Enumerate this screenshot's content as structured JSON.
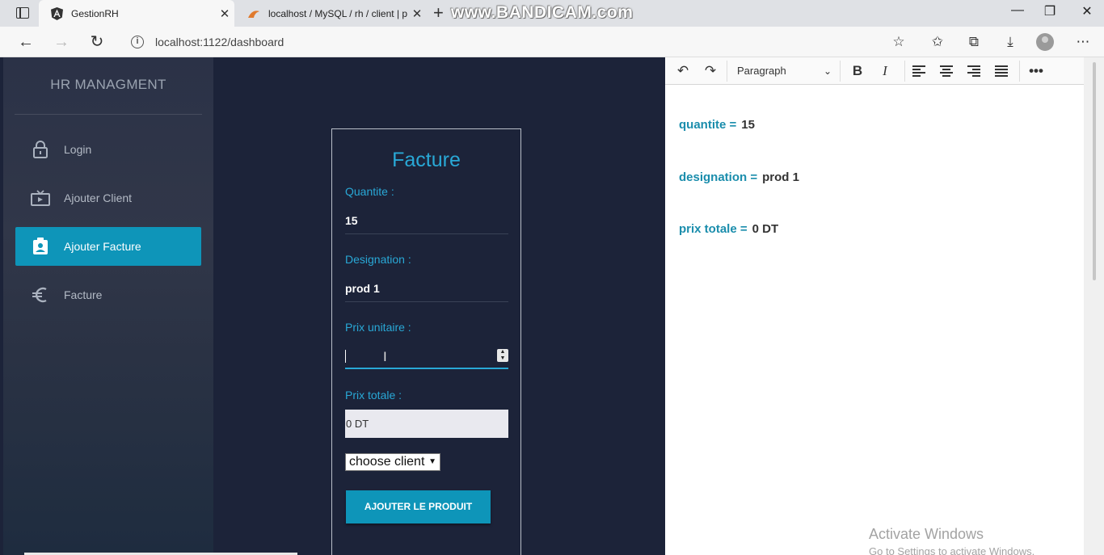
{
  "browser": {
    "tabs": [
      {
        "title": "GestionRH",
        "active": true
      },
      {
        "title": "localhost / MySQL / rh / client | p",
        "active": false
      }
    ],
    "recording_watermark": "www.BANDICAM.com",
    "url": "localhost:1122/dashboard"
  },
  "sidebar": {
    "brand": "HR MANAGMENT",
    "items": [
      {
        "label": "Login",
        "icon": "lock-icon",
        "active": false
      },
      {
        "label": "Ajouter Client",
        "icon": "tv-icon",
        "active": false
      },
      {
        "label": "Ajouter Facture",
        "icon": "clipboard-user-icon",
        "active": true
      },
      {
        "label": "Facture",
        "icon": "euro-icon",
        "active": false
      }
    ]
  },
  "form": {
    "title": "Facture",
    "quantite": {
      "label": "Quantite :",
      "value": "15"
    },
    "designation": {
      "label": "Designation :",
      "value": "prod 1"
    },
    "prix_unitaire": {
      "label": "Prix unitaire :",
      "value": ""
    },
    "prix_totale": {
      "label": "Prix totale :",
      "value": "0 DT"
    },
    "client_select": {
      "selected": "choose client"
    },
    "submit_label": "AJOUTER LE PRODUIT"
  },
  "editor": {
    "block_format": "Paragraph",
    "lines": [
      {
        "key": "quantite =",
        "value": "15"
      },
      {
        "key": "designation =",
        "value": "prod 1"
      },
      {
        "key": "prix totale =",
        "value": "0 DT"
      }
    ]
  },
  "os_watermark": {
    "line1": "Activate Windows",
    "line2": "Go to Settings to activate Windows."
  },
  "colors": {
    "accent": "#0e95b9",
    "label": "#29a8d6",
    "background": "#1c2339",
    "editor_key": "#1a8dac"
  }
}
